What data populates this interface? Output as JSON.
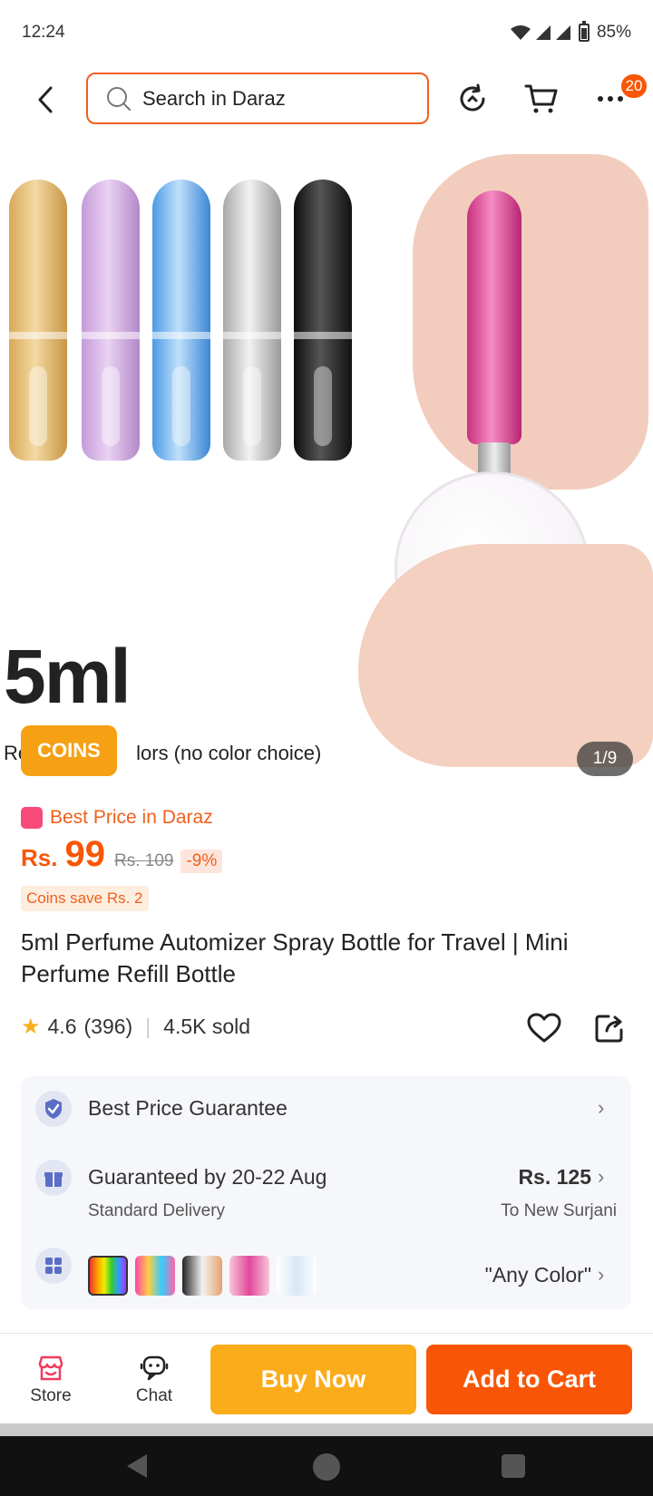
{
  "status_bar": {
    "time": "12:24",
    "battery": "85%"
  },
  "search": {
    "placeholder": "Search in Daraz"
  },
  "nav": {
    "more_badge": "20"
  },
  "gallery": {
    "big_text": "5ml",
    "caption": "Ro",
    "caption_rest": "lors (no color choice)",
    "coins_badge": "COINS",
    "counter": "1/9"
  },
  "price": {
    "best_price_label": "Best Price in Daraz",
    "currency": "Rs.",
    "value": "99",
    "old_price": "Rs. 109",
    "discount": "-9%",
    "coins_save": "Coins save Rs. 2"
  },
  "product": {
    "title": "5ml Perfume Automizer Spray Bottle for Travel | Mini Perfume Refill Bottle",
    "rating": "4.6",
    "rating_count": "(396)",
    "sold": "4.5K sold"
  },
  "info": {
    "guarantee_label": "Best Price Guarantee",
    "delivery_label": "Guaranteed by 20-22 Aug",
    "delivery_price": "Rs. 125",
    "delivery_type": "Standard Delivery",
    "delivery_to": "To New Surjani",
    "variant_value": "\"Any Color\""
  },
  "bottom_bar": {
    "store_label": "Store",
    "chat_label": "Chat",
    "buy_now_label": "Buy Now",
    "add_to_cart_label": "Add to Cart"
  },
  "colors": {
    "accent": "#f85606",
    "buy_now": "#fbac1b",
    "coins": "#f6a014"
  },
  "icons": [
    "back-arrow-icon",
    "search-icon",
    "history-icon",
    "cart-icon",
    "more-icon",
    "heart-icon",
    "share-icon",
    "shield-check-icon",
    "gift-icon",
    "variant-grid-icon",
    "store-icon",
    "chat-icon",
    "star-icon"
  ]
}
